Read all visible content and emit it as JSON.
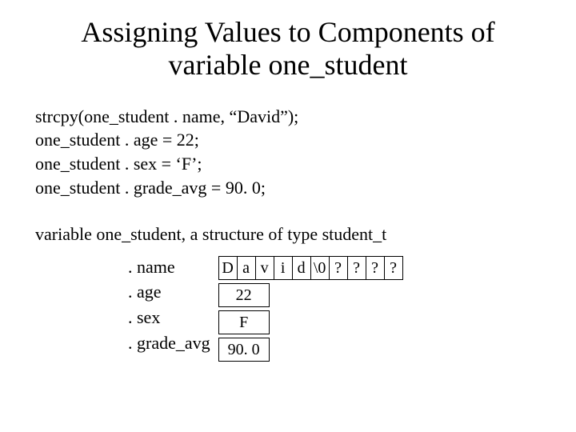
{
  "title_line1": "Assigning Values to Components of",
  "title_line2": "variable one_student",
  "code": {
    "l1": "strcpy(one_student . name, “David”);",
    "l2": "one_student . age = 22;",
    "l3": "one_student . sex = ‘F’;",
    "l4": "one_student . grade_avg = 90. 0;"
  },
  "explain": "variable one_student, a structure of type student_t",
  "labels": {
    "name": ". name",
    "age": ". age",
    "sex": ". sex",
    "grade_avg": ". grade_avg"
  },
  "name_chars": [
    "D",
    "a",
    "v",
    "i",
    "d",
    "\\0",
    "?",
    "?",
    "?",
    "?"
  ],
  "values": {
    "age": "22",
    "sex": "F",
    "grade_avg": "90. 0"
  }
}
